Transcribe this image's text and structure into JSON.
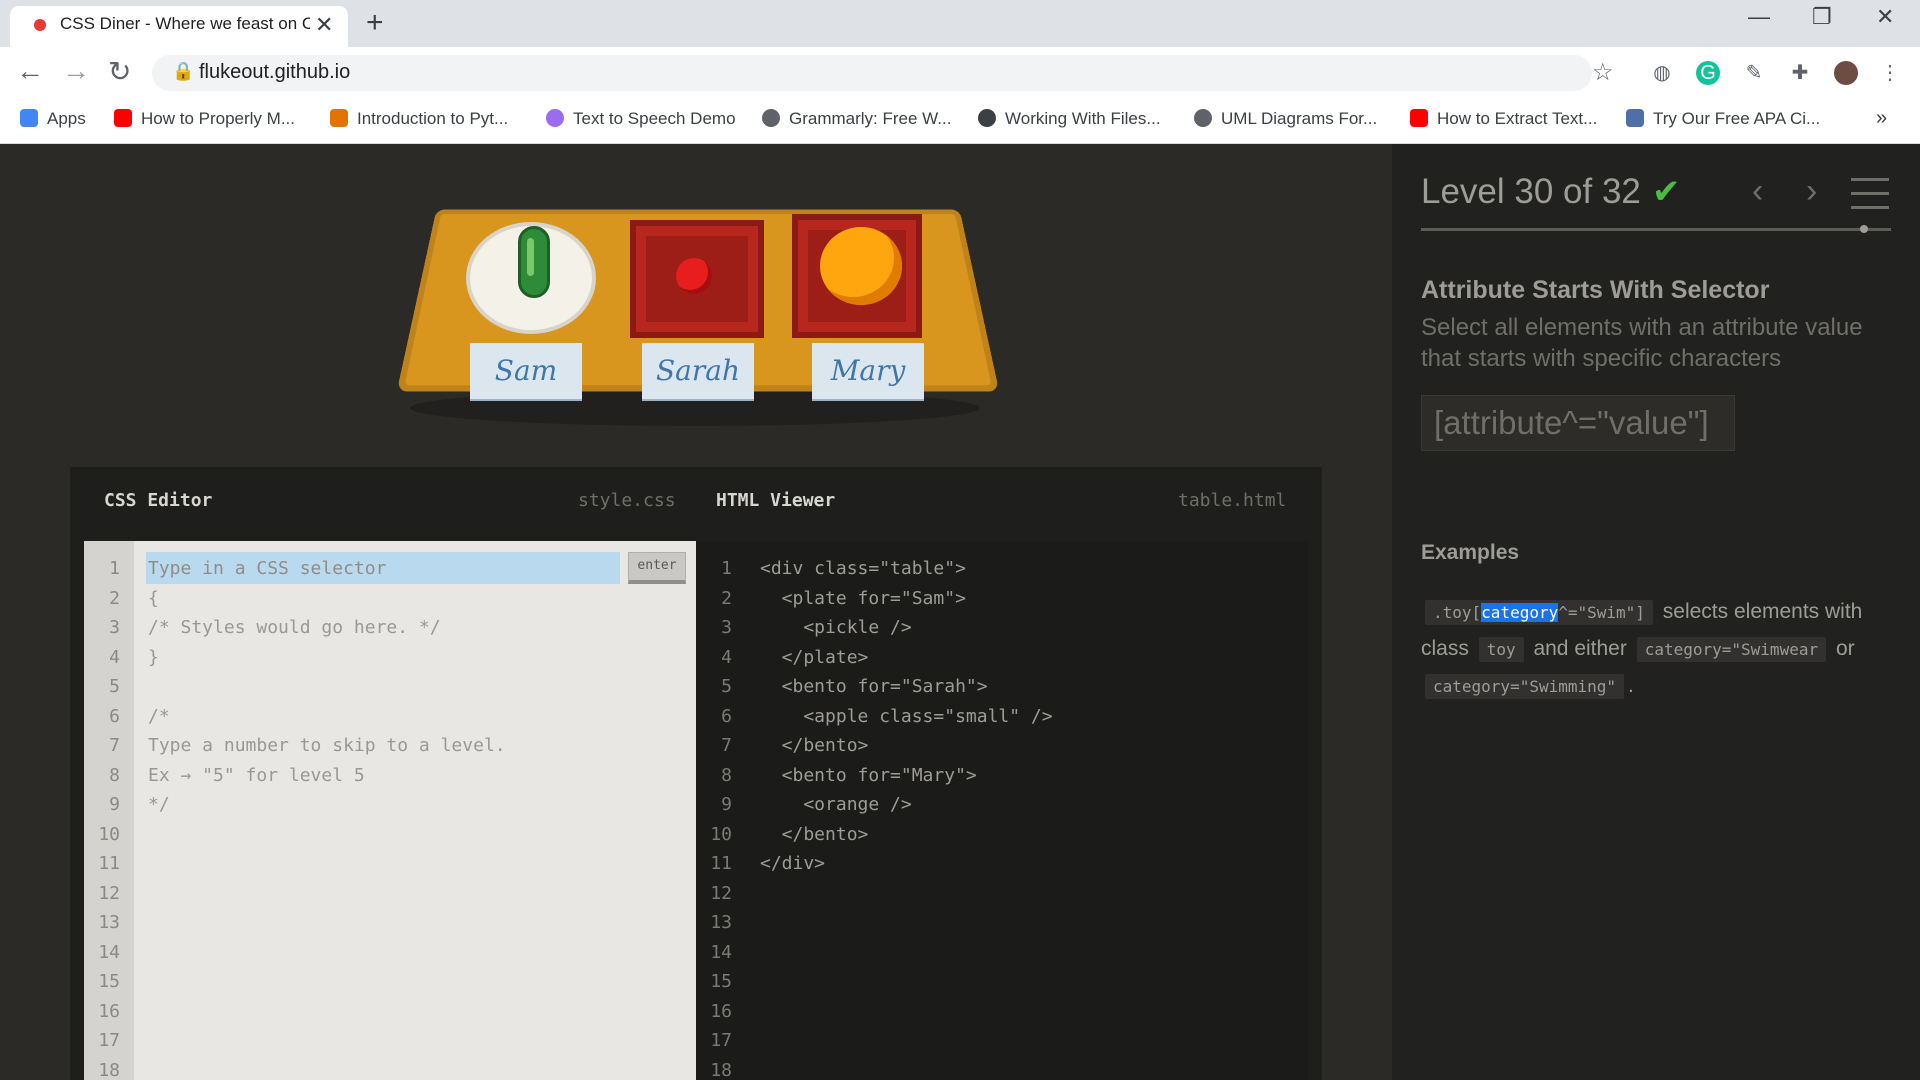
{
  "browser": {
    "tab_title": "CSS Diner - Where we feast on C",
    "url": "flukeout.github.io",
    "bookmarks": [
      "Apps",
      "How to Properly M...",
      "Introduction to Pyt...",
      "Text to Speech Demo",
      "Grammarly: Free W...",
      "Working With Files...",
      "UML Diagrams For...",
      "How to Extract Text...",
      "Try Our Free APA Ci..."
    ],
    "icons": {
      "back": "back-arrow-icon",
      "forward": "forward-arrow-icon",
      "reload": "reload-icon",
      "lock": "lock-icon",
      "star": "bookmark-star-icon"
    }
  },
  "game": {
    "level_title": "Level 30 of 32",
    "progress": 0.94,
    "selector_name": "Attribute Starts With Selector",
    "selector_desc": "Select all elements with an attribute value that starts with specific characters",
    "syntax": "[attribute^=\"value\"]",
    "examples_title": "Examples",
    "example": {
      "code_prefix": ".toy[",
      "code_highlight": "category",
      "code_suffix": "^=\"Swim\"]",
      "text1": "selects elements with class",
      "code_toy": "toy",
      "text2": "and either",
      "code_a": "category=\"Swimwear",
      "text3": "or",
      "code_b": "category=\"Swimming\"",
      "text4": "."
    },
    "nametags": [
      "Sam",
      "Sarah",
      "Mary"
    ]
  },
  "editor": {
    "css_title": "CSS Editor",
    "css_file": "style.css",
    "html_title": "HTML Viewer",
    "html_file": "table.html",
    "input_placeholder": "Type in a CSS selector",
    "enter_label": "enter",
    "css_lines": [
      "",
      "{",
      "/* Styles would go here. */",
      "}",
      "",
      "/*",
      "Type a number to skip to a level.",
      "Ex → \"5\" for level 5",
      "*/"
    ],
    "html_lines": [
      "<div class=\"table\">",
      "  <plate for=\"Sam\">",
      "    <pickle />",
      "  </plate>",
      "  <bento for=\"Sarah\">",
      "    <apple class=\"small\" />",
      "  </bento>",
      "  <bento for=\"Mary\">",
      "    <orange />",
      "  </bento>",
      "</div>"
    ],
    "line_numbers": [
      "1",
      "2",
      "3",
      "4",
      "5",
      "6",
      "7",
      "8",
      "9",
      "10",
      "11",
      "12",
      "13",
      "14",
      "15",
      "16",
      "17",
      "18"
    ]
  }
}
